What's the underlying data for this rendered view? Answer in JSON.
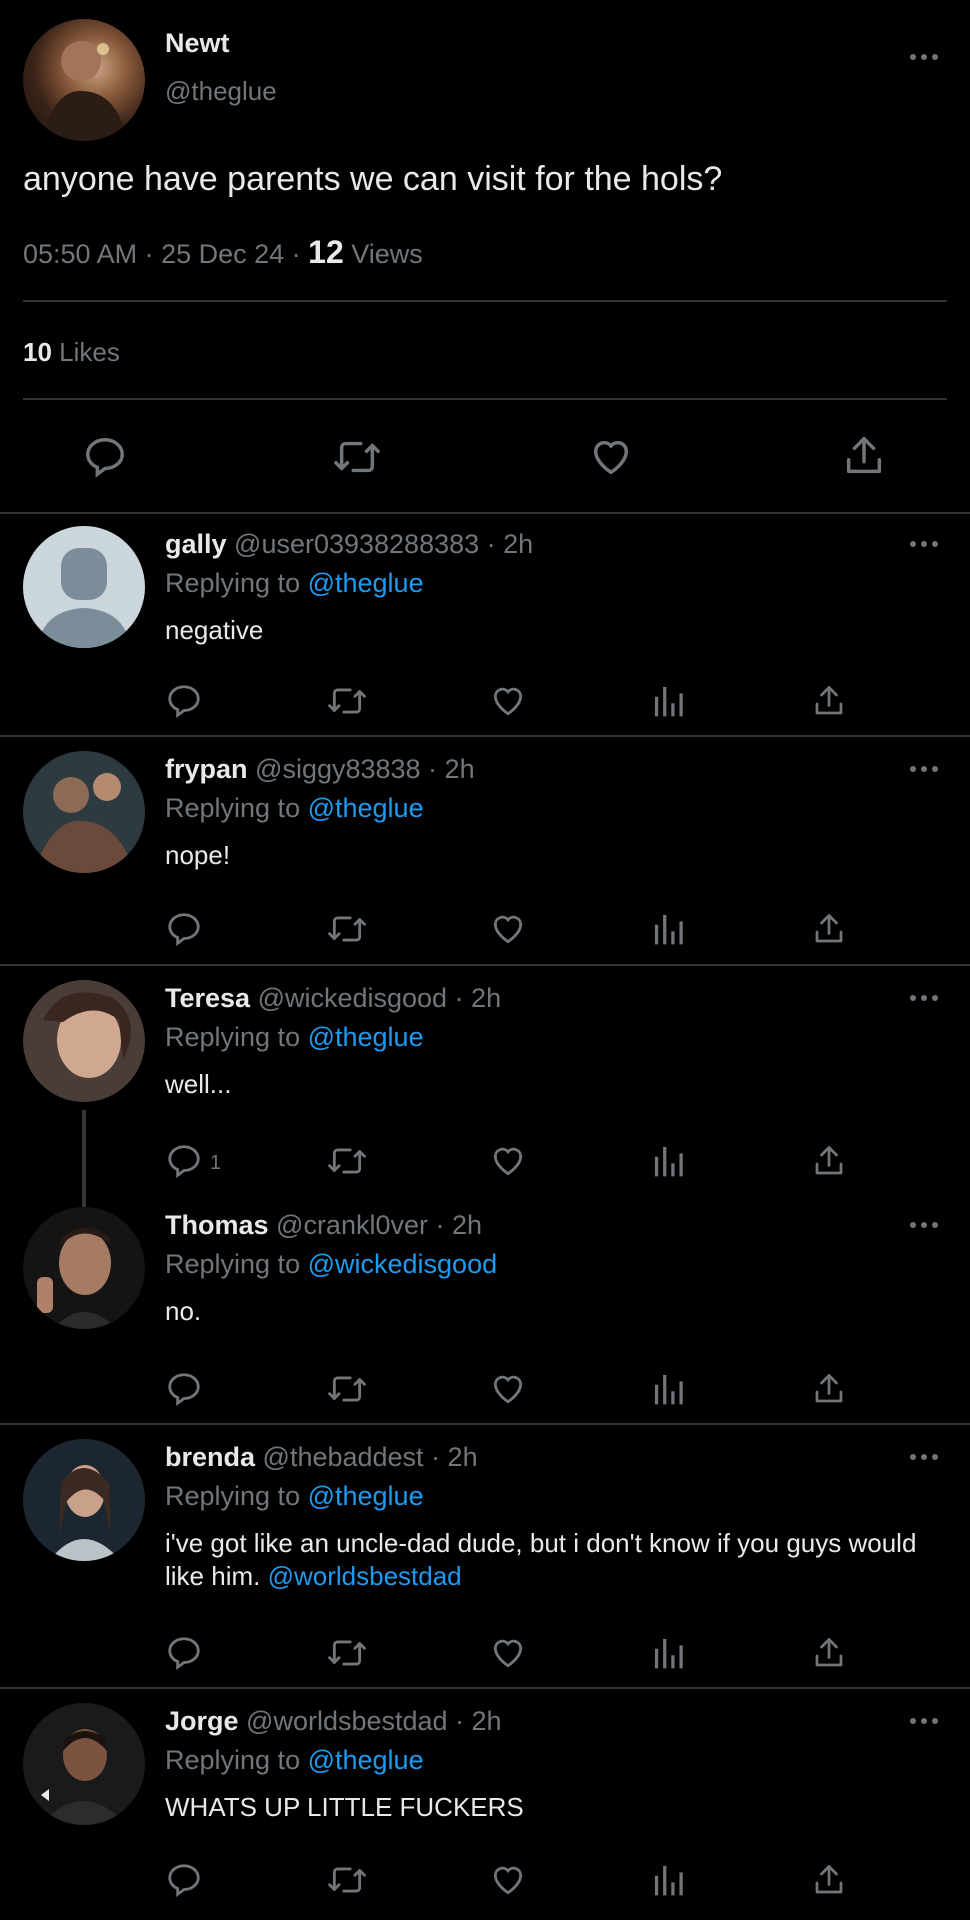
{
  "tweet": {
    "name": "Newt",
    "handle": "@theglue",
    "text": "anyone have parents we can visit for the hols?",
    "time": "05:50 AM · 25 Dec 24 · ",
    "views_count": "12",
    "views_label": "Views",
    "likes_count": "10",
    "likes_label": "Likes"
  },
  "icons": {
    "reply": "reply-icon",
    "retweet": "retweet-icon",
    "like": "heart-icon",
    "analytics": "analytics-icon",
    "share": "share-icon",
    "more": "more-icon"
  },
  "colors": {
    "background": "#000000",
    "text": "#e7e9ea",
    "muted": "#71767b",
    "link": "#1d9bf0",
    "divider": "#2f3336"
  },
  "replies": [
    {
      "name": "gally",
      "meta": " @user03938288383 · 2h",
      "replying_label": "Replying to ",
      "replying_to": "@theglue",
      "text": "negative",
      "reply_count": ""
    },
    {
      "name": "frypan",
      "meta": " @siggy83838 · 2h",
      "replying_label": "Replying to ",
      "replying_to": "@theglue",
      "text": "nope!",
      "reply_count": ""
    },
    {
      "name": "Teresa",
      "meta": " @wickedisgood · 2h",
      "replying_label": "Replying to ",
      "replying_to": "@theglue",
      "text": "well...",
      "reply_count": "1"
    },
    {
      "name": "Thomas",
      "meta": " @crankl0ver · 2h",
      "replying_label": "Replying to ",
      "replying_to": "@wickedisgood",
      "text": "no.",
      "reply_count": ""
    },
    {
      "name": "brenda",
      "meta": " @thebaddest · 2h",
      "replying_label": "Replying to ",
      "replying_to": "@theglue",
      "text": "i've got like an uncle-dad dude, but i don't know if you guys would like him. ",
      "mention": "@worldsbestdad",
      "reply_count": ""
    },
    {
      "name": "Jorge",
      "meta": " @worldsbestdad · 2h",
      "replying_label": "Replying to ",
      "replying_to": "@theglue",
      "text": "WHATS UP LITTLE FUCKERS",
      "reply_count": ""
    }
  ]
}
